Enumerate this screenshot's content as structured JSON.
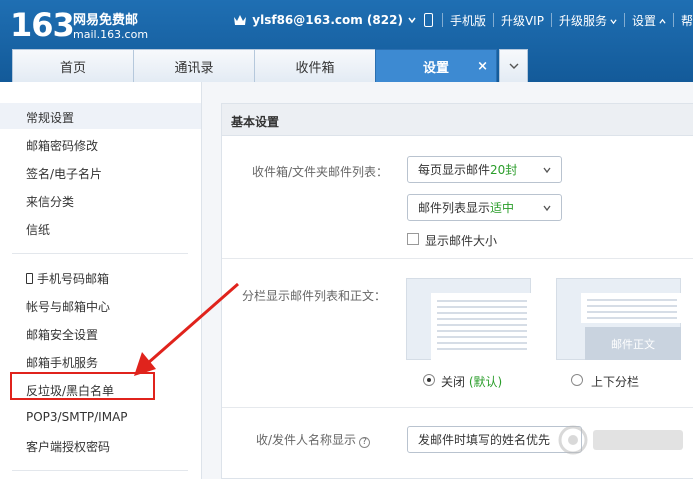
{
  "header": {
    "logo_number": "163",
    "logo_title": "网易免费邮",
    "logo_domain": "mail.163.com",
    "user_account": "ylsf86@163.com (822)",
    "links": {
      "mobile": "手机版",
      "vip": "升级VIP",
      "upgrade_service": "升级服务",
      "settings": "设置",
      "more": "帮"
    }
  },
  "tabs": [
    {
      "label": "首页"
    },
    {
      "label": "通讯录"
    },
    {
      "label": "收件箱"
    },
    {
      "label": "设置",
      "close": "×"
    }
  ],
  "sidebar": {
    "group1": [
      "常规设置",
      "邮箱密码修改",
      "签名/电子名片",
      "来信分类",
      "信纸"
    ],
    "group2": [
      "手机号码邮箱",
      "帐号与邮箱中心",
      "邮箱安全设置",
      "邮箱手机服务",
      "反垃圾/黑白名单",
      "POP3/SMTP/IMAP",
      "客户端授权密码"
    ]
  },
  "main": {
    "section_title": "基本设置",
    "list_label": "收件箱/文件夹邮件列表：",
    "per_page_select": {
      "prefix": "每页显示邮件",
      "value": "20封"
    },
    "list_display_select": {
      "prefix": "邮件列表显示",
      "value": "适中"
    },
    "show_size_label": "显示邮件大小",
    "split_label": "分栏显示邮件列表和正文：",
    "preview_body_text": "邮件正文",
    "radio_off": {
      "label": "关闭",
      "note": "(默认)"
    },
    "radio_split": {
      "label": "上下分栏"
    },
    "name_display_label": "收/发件人名称显示",
    "name_display_select": "发邮件时填写的姓名优先",
    "help_glyph": "?"
  },
  "colors": {
    "header_blue": "#1a66a8",
    "active_tab": "#3d8ad2",
    "vip_orange": "#f5a623",
    "highlight_red": "#e0231c",
    "value_green": "#2a9d2a"
  }
}
